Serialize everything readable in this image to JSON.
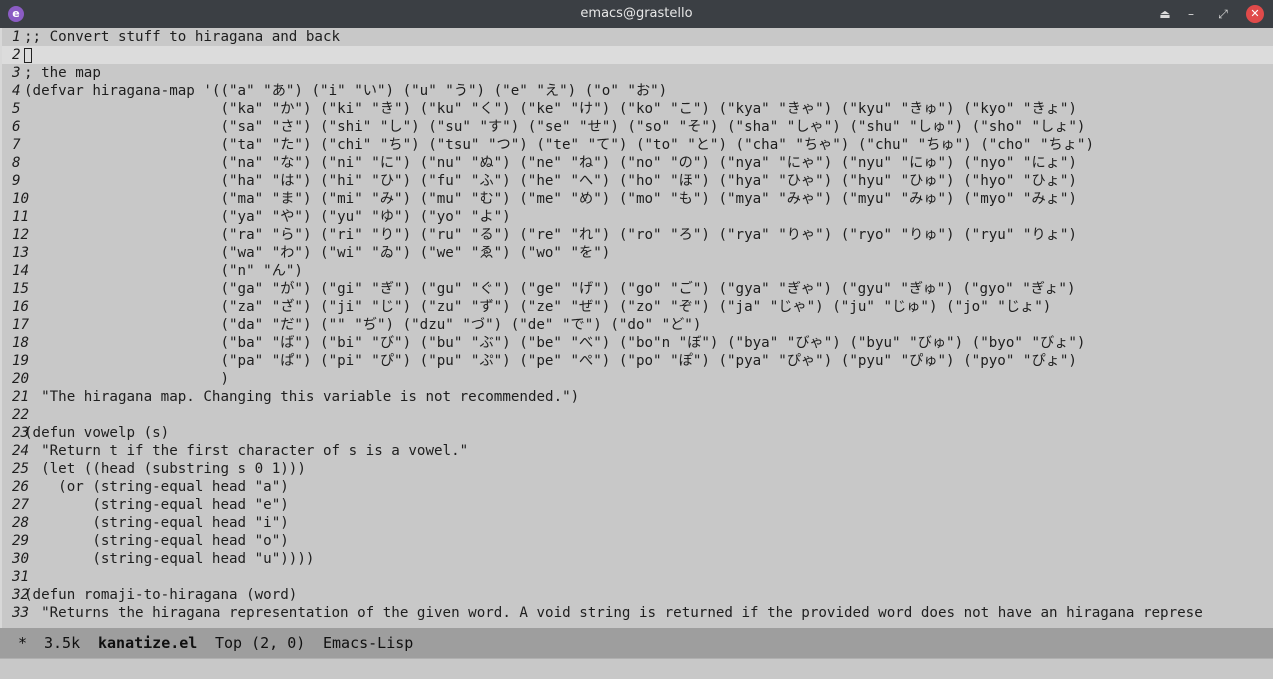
{
  "window": {
    "title": "emacs@grastello",
    "app_icon": "emacs-icon",
    "buttons": [
      {
        "icon": "eject-icon",
        "glyph": "⏏"
      },
      {
        "icon": "minimize-icon",
        "glyph": "–"
      },
      {
        "icon": "restore-icon",
        "glyph": "⤢"
      },
      {
        "icon": "close-icon",
        "glyph": "✕"
      }
    ]
  },
  "editor": {
    "current_line": 2,
    "lines": [
      ";; Convert stuff to hiragana and back",
      "",
      "; the map",
      "(defvar hiragana-map '((\"a\" \"あ\") (\"i\" \"い\") (\"u\" \"う\") (\"e\" \"え\") (\"o\" \"お\")",
      "                       (\"ka\" \"か\") (\"ki\" \"き\") (\"ku\" \"く\") (\"ke\" \"け\") (\"ko\" \"こ\") (\"kya\" \"きゃ\") (\"kyu\" \"きゅ\") (\"kyo\" \"きょ\")",
      "                       (\"sa\" \"さ\") (\"shi\" \"し\") (\"su\" \"す\") (\"se\" \"せ\") (\"so\" \"そ\") (\"sha\" \"しゃ\") (\"shu\" \"しゅ\") (\"sho\" \"しょ\")",
      "                       (\"ta\" \"た\") (\"chi\" \"ち\") (\"tsu\" \"つ\") (\"te\" \"て\") (\"to\" \"と\") (\"cha\" \"ちゃ\") (\"chu\" \"ちゅ\") (\"cho\" \"ちょ\")",
      "                       (\"na\" \"な\") (\"ni\" \"に\") (\"nu\" \"ぬ\") (\"ne\" \"ね\") (\"no\" \"の\") (\"nya\" \"にゃ\") (\"nyu\" \"にゅ\") (\"nyo\" \"にょ\")",
      "                       (\"ha\" \"は\") (\"hi\" \"ひ\") (\"fu\" \"ふ\") (\"he\" \"へ\") (\"ho\" \"ほ\") (\"hya\" \"ひゃ\") (\"hyu\" \"ひゅ\") (\"hyo\" \"ひょ\")",
      "                       (\"ma\" \"ま\") (\"mi\" \"み\") (\"mu\" \"む\") (\"me\" \"め\") (\"mo\" \"も\") (\"mya\" \"みゃ\") (\"myu\" \"みゅ\") (\"myo\" \"みょ\")",
      "                       (\"ya\" \"や\") (\"yu\" \"ゆ\") (\"yo\" \"よ\")",
      "                       (\"ra\" \"ら\") (\"ri\" \"り\") (\"ru\" \"る\") (\"re\" \"れ\") (\"ro\" \"ろ\") (\"rya\" \"りゃ\") (\"ryo\" \"りゅ\") (\"ryu\" \"りょ\")",
      "                       (\"wa\" \"わ\") (\"wi\" \"ゐ\") (\"we\" \"ゑ\") (\"wo\" \"を\")",
      "                       (\"n\" \"ん\")",
      "                       (\"ga\" \"が\") (\"gi\" \"ぎ\") (\"gu\" \"ぐ\") (\"ge\" \"げ\") (\"go\" \"ご\") (\"gya\" \"ぎゃ\") (\"gyu\" \"ぎゅ\") (\"gyo\" \"ぎょ\")",
      "                       (\"za\" \"ざ\") (\"ji\" \"じ\") (\"zu\" \"ず\") (\"ze\" \"ぜ\") (\"zo\" \"ぞ\") (\"ja\" \"じゃ\") (\"ju\" \"じゅ\") (\"jo\" \"じょ\")",
      "                       (\"da\" \"だ\") (\"\" \"ぢ\") (\"dzu\" \"づ\") (\"de\" \"で\") (\"do\" \"ど\")",
      "                       (\"ba\" \"ば\") (\"bi\" \"び\") (\"bu\" \"ぶ\") (\"be\" \"べ\") (\"bo\"n \"ぼ\") (\"bya\" \"びゃ\") (\"byu\" \"びゅ\") (\"byo\" \"びょ\")",
      "                       (\"pa\" \"ぱ\") (\"pi\" \"ぴ\") (\"pu\" \"ぷ\") (\"pe\" \"ぺ\") (\"po\" \"ぽ\") (\"pya\" \"ぴゃ\") (\"pyu\" \"ぴゅ\") (\"pyo\" \"ぴょ\")",
      "                       )",
      "  \"The hiragana map. Changing this variable is not recommended.\")",
      "",
      "(defun vowelp (s)",
      "  \"Return t if the first character of s is a vowel.\"",
      "  (let ((head (substring s 0 1)))",
      "    (or (string-equal head \"a\")",
      "        (string-equal head \"e\")",
      "        (string-equal head \"i\")",
      "        (string-equal head \"o\")",
      "        (string-equal head \"u\"))))",
      "",
      "(defun romaji-to-hiragana (word)",
      "  \"Returns the hiragana representation of the given word. A void string is returned if the provided word does not have an hiragana represe"
    ]
  },
  "modeline": {
    "modified": "*",
    "size": "3.5k",
    "buffer_name": "kanatize.el",
    "position": "Top (2, 0)",
    "mode": "Emacs-Lisp"
  },
  "minibuffer": {
    "text": ""
  }
}
